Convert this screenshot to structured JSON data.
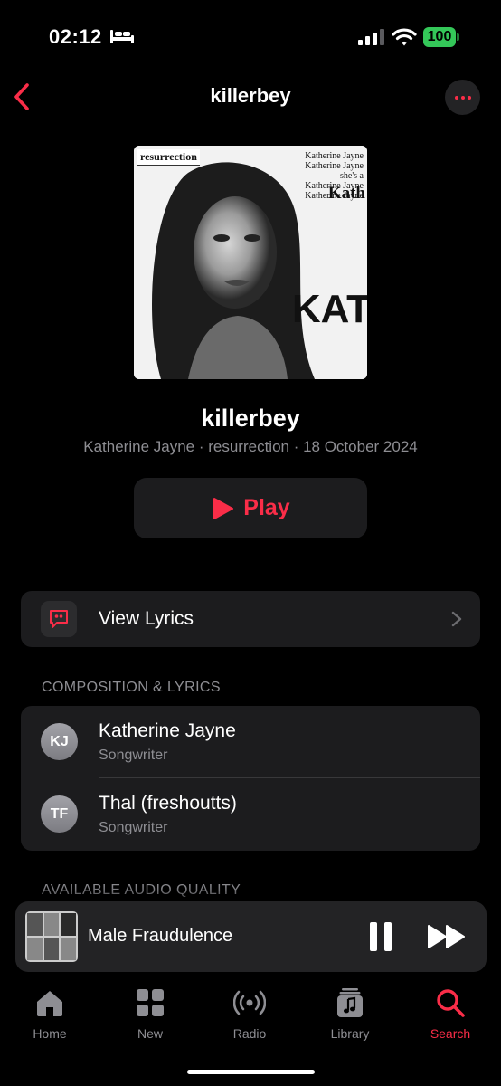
{
  "status_bar": {
    "time": "02:12",
    "battery": "100"
  },
  "nav": {
    "title": "killerbey"
  },
  "artwork": {
    "label": "resurrection",
    "text_lines": [
      "Katherine Jayne",
      "Katherine Jayne",
      "she's a",
      "Katherine Jayne",
      "Katherine Jayne"
    ],
    "big_word": "Kath",
    "huge_word": "KAT"
  },
  "song": {
    "title": "killerbey",
    "subtitle": "Katherine Jayne · resurrection · 18 October 2024",
    "play_label": "Play"
  },
  "lyrics": {
    "label": "View Lyrics"
  },
  "sections": {
    "composition": "COMPOSITION & LYRICS",
    "audio_quality": "AVAILABLE AUDIO QUALITY"
  },
  "credits": [
    {
      "initials": "KJ",
      "name": "Katherine Jayne",
      "role": "Songwriter"
    },
    {
      "initials": "TF",
      "name": "Thal (freshoutts)",
      "role": "Songwriter"
    }
  ],
  "mini_player": {
    "title": "Male Fraudulence"
  },
  "tabs": [
    {
      "label": "Home",
      "icon": "home-icon"
    },
    {
      "label": "New",
      "icon": "grid-icon"
    },
    {
      "label": "Radio",
      "icon": "radio-icon"
    },
    {
      "label": "Library",
      "icon": "library-icon"
    },
    {
      "label": "Search",
      "icon": "search-icon",
      "active": true
    }
  ],
  "colors": {
    "accent": "#fa2d48",
    "card": "#1c1c1e",
    "secondary_text": "#8e8e93",
    "battery": "#34c759"
  }
}
